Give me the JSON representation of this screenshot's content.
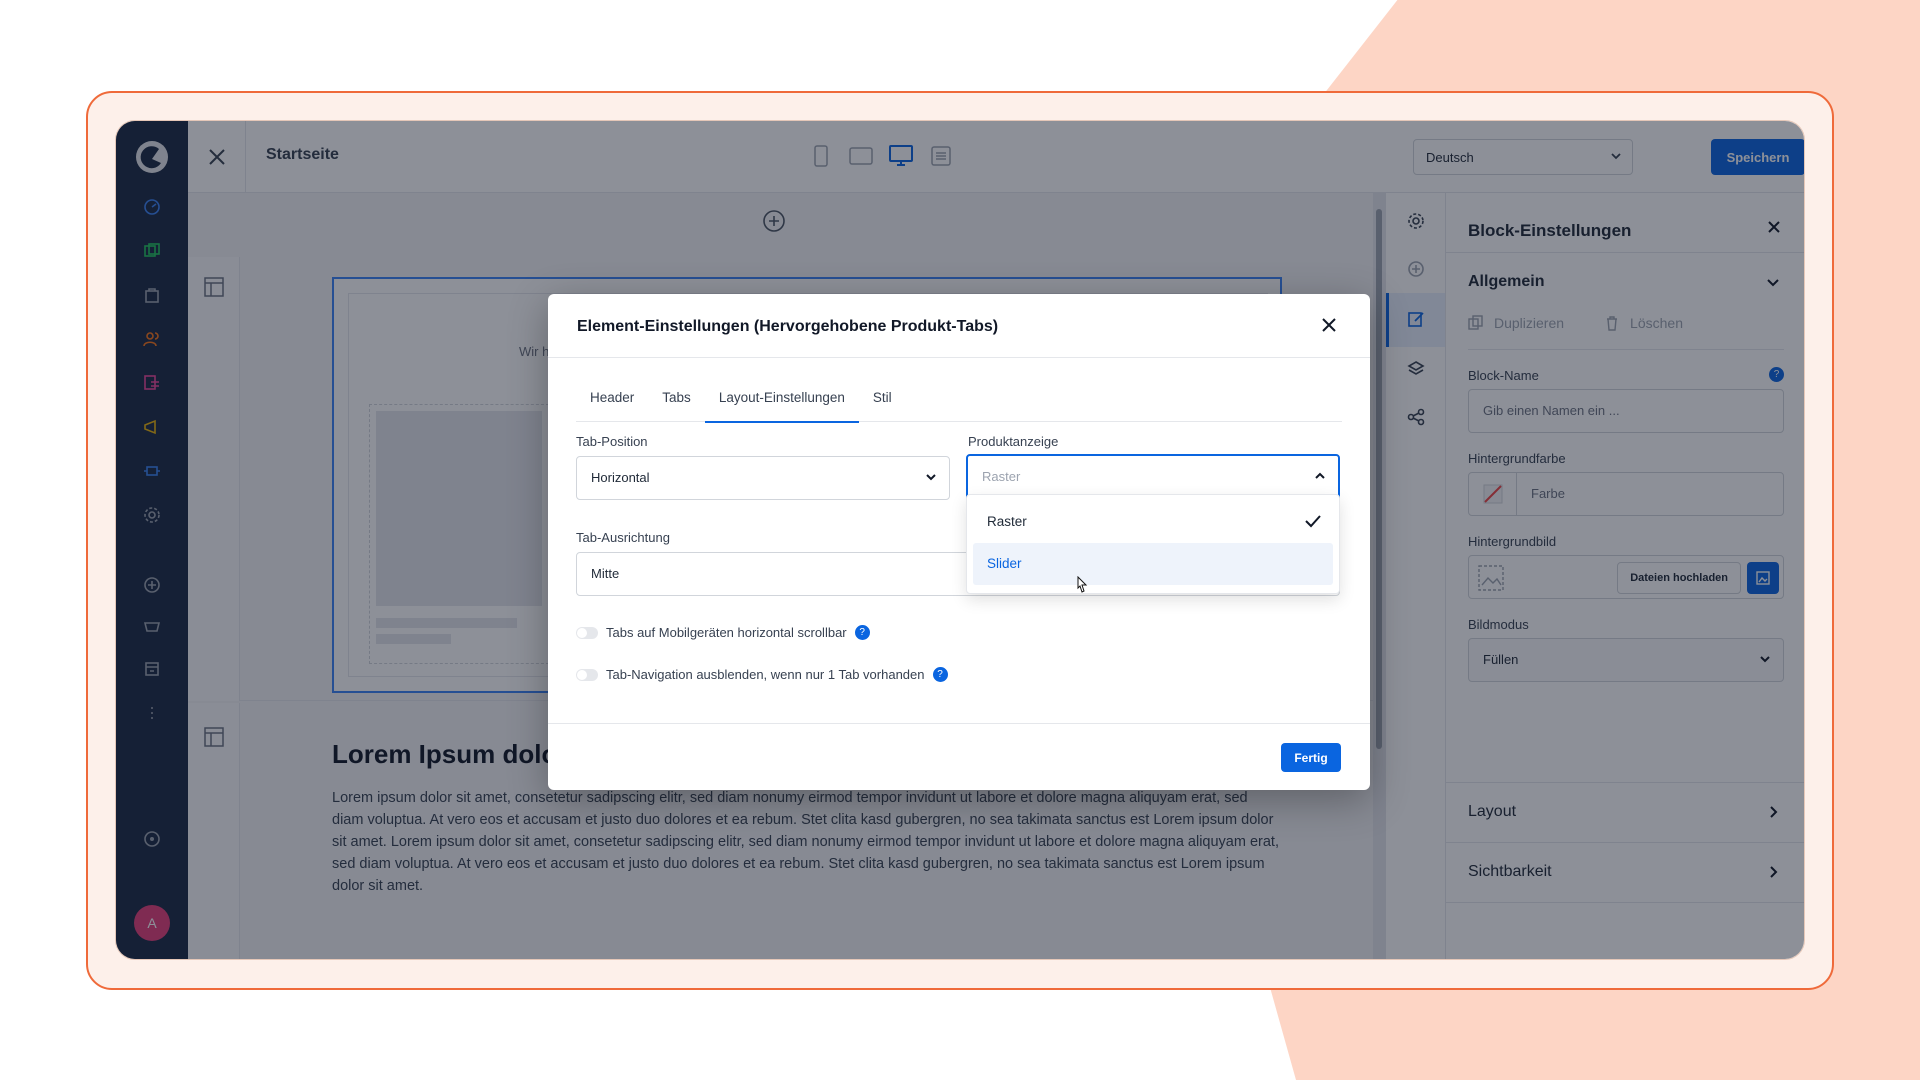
{
  "header": {
    "page_title": "Startseite",
    "language": "Deutsch",
    "save_label": "Speichern"
  },
  "rail": {
    "avatar_initial": "A"
  },
  "canvas": {
    "intro_text": "Wir h",
    "section_title": "Lorem Ipsum dolo",
    "section_text": "Lorem ipsum dolor sit amet, consetetur sadipscing elitr, sed diam nonumy eirmod tempor invidunt ut labore et dolore magna aliquyam erat, sed diam voluptua. At vero eos et accusam et justo duo dolores et ea rebum. Stet clita kasd gubergren, no sea takimata sanctus est Lorem ipsum dolor sit amet. Lorem ipsum dolor sit amet, consetetur sadipscing elitr, sed diam nonumy eirmod tempor invidunt ut labore et dolore magna aliquyam erat, sed diam voluptua. At vero eos et accusam et justo duo dolores et ea rebum. Stet clita kasd gubergren, no sea takimata sanctus est Lorem ipsum dolor sit amet."
  },
  "sidebar": {
    "title": "Block-Einstellungen",
    "general": {
      "title": "Allgemein",
      "duplicate": "Duplizieren",
      "delete": "Löschen",
      "block_name_label": "Block-Name",
      "block_name_placeholder": "Gib einen Namen ein ...",
      "bg_color_label": "Hintergrundfarbe",
      "bg_color_placeholder": "Farbe",
      "bg_image_label": "Hintergrundbild",
      "upload_label": "Dateien hochladen",
      "image_mode_label": "Bildmodus",
      "image_mode_value": "Füllen"
    },
    "layout": "Layout",
    "visibility": "Sichtbarkeit"
  },
  "modal": {
    "title": "Element-Einstellungen (Hervorgehobene Produkt-Tabs)",
    "tabs": [
      "Header",
      "Tabs",
      "Layout-Einstellungen",
      "Stil"
    ],
    "active_tab": "Layout-Einstellungen",
    "tab_position_label": "Tab-Position",
    "tab_position_value": "Horizontal",
    "product_display_label": "Produktanzeige",
    "product_display_value": "Raster",
    "tab_alignment_label": "Tab-Ausrichtung",
    "tab_alignment_value": "Mitte",
    "toggle_scroll": "Tabs auf Mobilgeräten horizontal scrollbar",
    "toggle_hide_nav": "Tab-Navigation ausblenden, wenn nur 1 Tab vorhanden",
    "done_label": "Fertig",
    "dropdown_options": [
      "Raster",
      "Slider"
    ],
    "dropdown_selected": "Raster",
    "dropdown_hovered": "Slider"
  },
  "colors": {
    "accent": "#0a65e0",
    "rail_bg": "#1a2a44",
    "frame_border": "#ef6a3a",
    "bg_shape": "#fdd5c5"
  }
}
